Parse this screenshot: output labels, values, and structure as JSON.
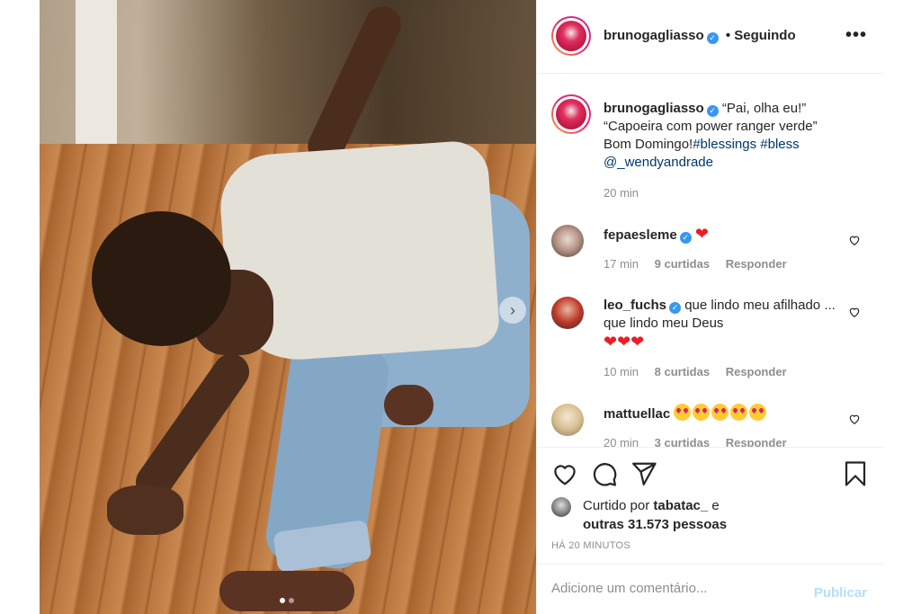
{
  "post": {
    "author": "brunogagliasso",
    "follow_status": "• Seguindo",
    "more_icon": "•••",
    "caption": {
      "line1": "“Pai, olha eu!”",
      "line2": "“Capoeira com power ranger verde”",
      "line3_text": "Bom Domingo!",
      "hashtag1": "#blessings",
      "hashtag2": "#bless",
      "mention": "@_wendyandrade",
      "time": "20 min"
    },
    "carousel": {
      "next_icon": "›",
      "current_slide": 1,
      "total_slides": 2
    }
  },
  "comments": [
    {
      "user": "fepaesleme",
      "verified": true,
      "text": "",
      "emoji": "❤",
      "time": "17 min",
      "likes": "9 curtidas",
      "reply": "Responder"
    },
    {
      "user": "leo_fuchs",
      "verified": true,
      "text": "que lindo meu afilhado ... que lindo meu Deus",
      "emoji": "❤❤❤",
      "time": "10 min",
      "likes": "8 curtidas",
      "reply": "Responder"
    },
    {
      "user": "mattuellac",
      "verified": false,
      "text": "",
      "emoji": "😍😍😍😍😍",
      "time": "20 min",
      "likes": "3 curtidas",
      "reply": "Responder"
    }
  ],
  "actions": {
    "icons": [
      "heart-icon",
      "comment-icon",
      "share-icon",
      "bookmark-icon"
    ],
    "liked_by_prefix": "Curtido por",
    "liked_by_user": "tabatac_",
    "liked_by_join": "e",
    "liked_by_others": "outras 31.573 pessoas",
    "timestamp": "HÁ 20 MINUTOS"
  },
  "add_comment": {
    "placeholder": "Adicione um comentário...",
    "publish_label": "Publicar"
  },
  "colors": {
    "link": "#00376b",
    "verified": "#3897f0",
    "muted": "#8e8e8e",
    "publish_disabled": "#b2dffc",
    "heart_red": "#ed1c24"
  }
}
